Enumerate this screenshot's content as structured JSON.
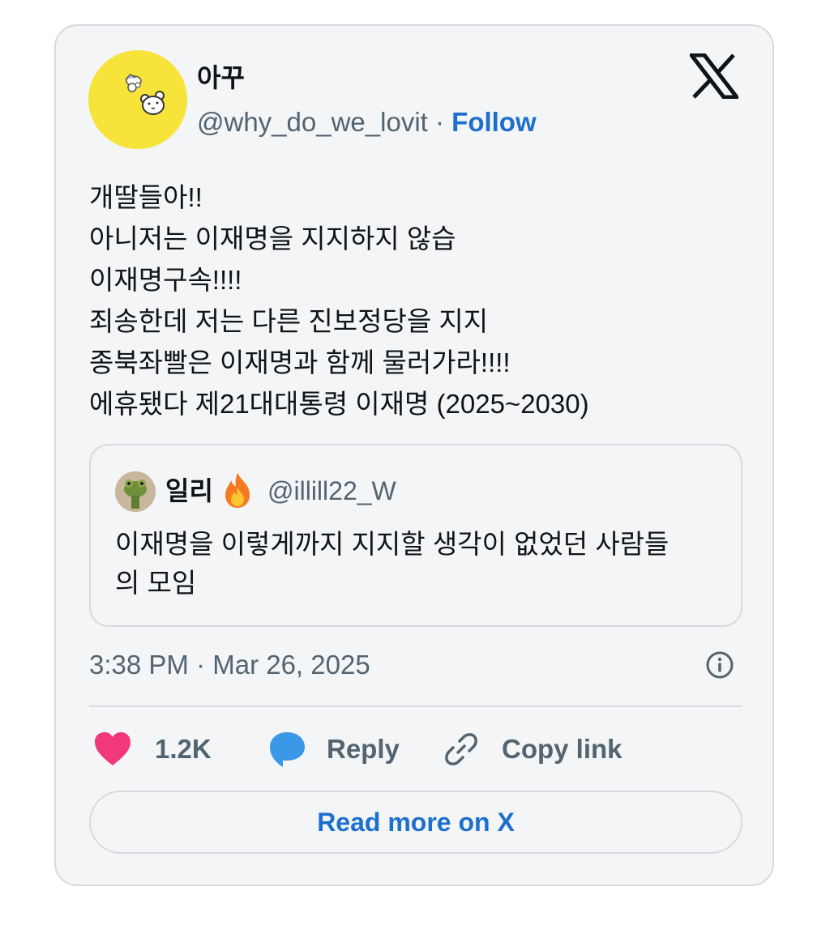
{
  "author": {
    "display_name": "아꾸",
    "handle": "@why_do_we_lovit",
    "separator": " · ",
    "follow_label": "Follow",
    "avatar_color": "#f6e43a"
  },
  "brand": {
    "logo_icon": "x-logo-icon"
  },
  "tweet": {
    "lines": [
      "개딸들아!!",
      "아니저는 이재명을 지지하지 않습",
      "이재명구속!!!!",
      "죄송한데 저는 다른 진보정당을 지지",
      "종북좌빨은 이재명과 함께 물러가라!!!!",
      "에휴됐다 제21대대통령 이재명 (2025~2030)"
    ]
  },
  "quote": {
    "display_name": "일리",
    "name_emoji_icon": "fire-icon",
    "handle": "@illill22_W",
    "text": "이재명을 이렇게까지 지지할 생각이 없었던 사람들의 모임",
    "text_line1": "이재명을 이렇게까지 지지할 생각이 없었던 사람들",
    "text_line2": "의 모임"
  },
  "meta": {
    "timestamp": "3:38 PM · Mar 26, 2025",
    "info_icon": "info-icon"
  },
  "actions": {
    "like_count": "1.2K",
    "reply_label": "Reply",
    "copy_link_label": "Copy link"
  },
  "read_more_label": "Read more on X",
  "colors": {
    "link_blue": "#1d6fcf",
    "heart_pink": "#f0387a",
    "reply_blue": "#3a98e6",
    "muted_text": "#536471",
    "card_bg": "#f4f5f6"
  }
}
